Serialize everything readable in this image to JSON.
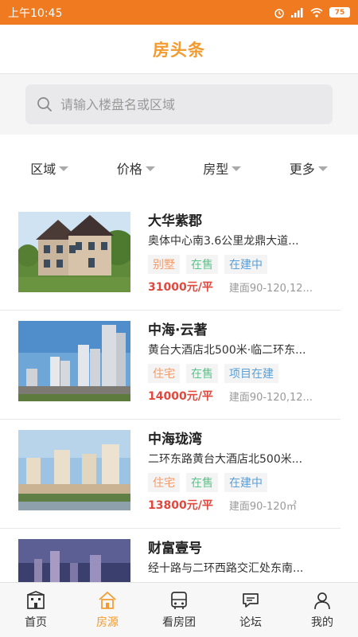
{
  "status_bar": {
    "time": "上午10:45",
    "battery": "75"
  },
  "header": {
    "title": "房头条"
  },
  "search": {
    "placeholder": "请输入楼盘名或区域"
  },
  "filters": [
    "区域",
    "价格",
    "房型",
    "更多"
  ],
  "listings": [
    {
      "name": "大华紫郡",
      "address": "奥体中心南3.6公里龙鼎大道...",
      "tags": [
        "别墅",
        "在售",
        "在建中"
      ],
      "price": "31000元/平",
      "area": "建面90-120,12..."
    },
    {
      "name": "中海·云著",
      "address": "黄台大酒店北500米·临二环东...",
      "tags": [
        "住宅",
        "在售",
        "项目在建"
      ],
      "price": "14000元/平",
      "area": "建面90-120,12..."
    },
    {
      "name": "中海珑湾",
      "address": "二环东路黄台大酒店北500米...",
      "tags": [
        "住宅",
        "在售",
        "在建中"
      ],
      "price": "13800元/平",
      "area": "建面90-120㎡"
    },
    {
      "name": "财富壹号",
      "address": "经十路与二环西路交汇处东南..."
    }
  ],
  "bottom_nav": {
    "home": "首页",
    "listings": "房源",
    "tour": "看房团",
    "forum": "论坛",
    "mine": "我的"
  },
  "colors": {
    "accent": "#F07A1F",
    "title": "#F39B2E",
    "price": "#E0483E"
  }
}
